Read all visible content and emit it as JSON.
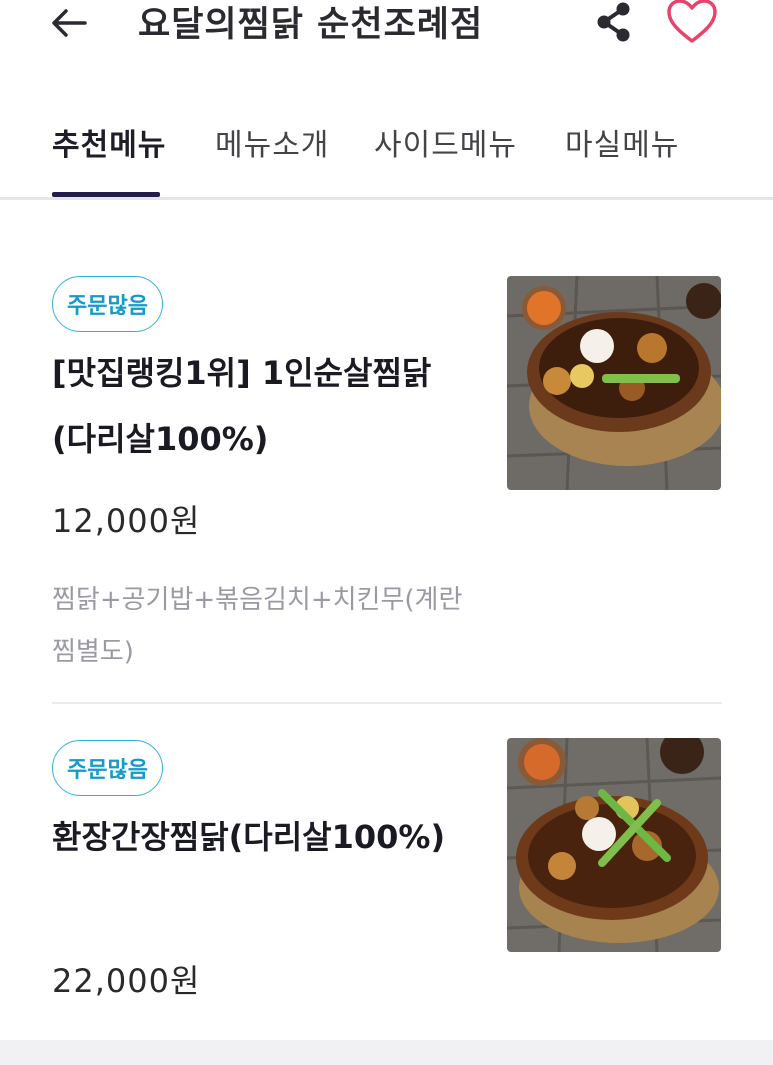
{
  "header": {
    "title": "요달의찜닭 순천조례점",
    "back_icon": "arrow-left-icon",
    "share_icon": "share-icon",
    "favorite_icon": "heart-icon",
    "favorite_color": "#e8436f"
  },
  "tabs": [
    {
      "label": "추천메뉴",
      "active": true
    },
    {
      "label": "메뉴소개",
      "active": false
    },
    {
      "label": "사이드메뉴",
      "active": false
    },
    {
      "label": "마실메뉴",
      "active": false
    }
  ],
  "menu": {
    "items": [
      {
        "badge": "주문많음",
        "name": "[맛집랭킹1위] 1인순살찜닭(다리살100%)",
        "price": "12,000원",
        "description": "찜닭+공기밥+볶음김치+치킨무(계란찜별도)"
      },
      {
        "badge": "주문많음",
        "name": "환장간장찜닭(다리살100%)",
        "price": "22,000원",
        "description": ""
      }
    ]
  },
  "colors": {
    "badge_border": "#33b4d9",
    "badge_text": "#159bc8",
    "tab_underline": "#1f1f4a"
  }
}
